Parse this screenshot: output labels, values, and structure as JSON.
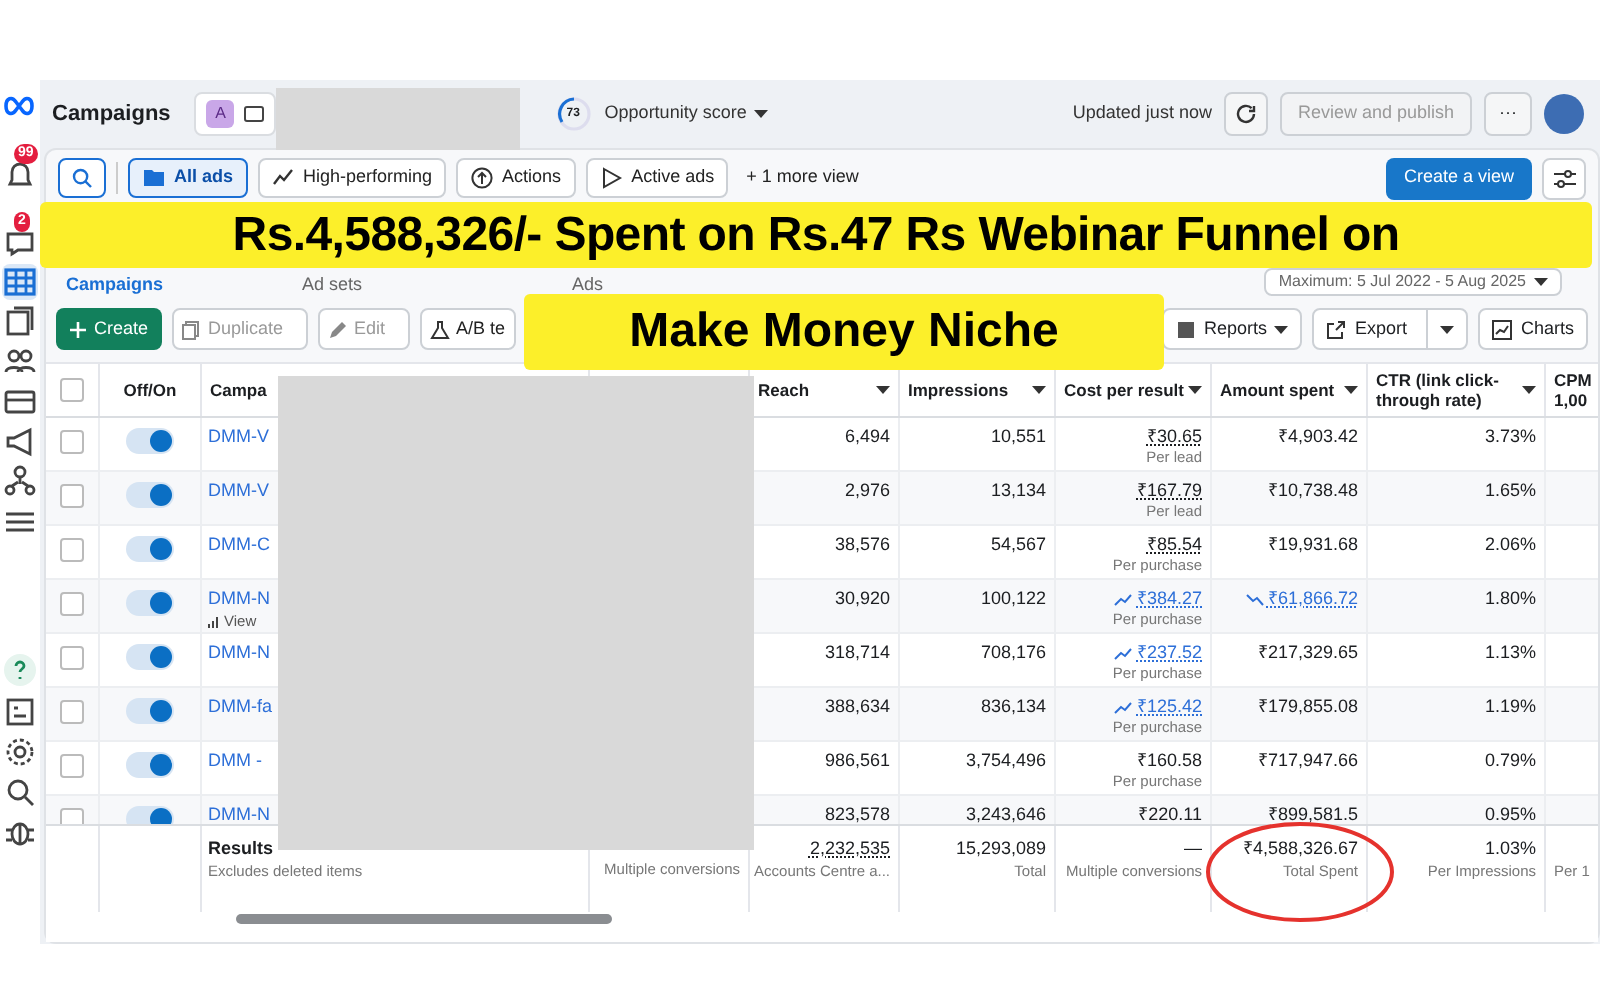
{
  "sidebar": {
    "items": [
      {
        "selected": false
      },
      {
        "selected": false,
        "badge": "99"
      },
      {
        "selected": false,
        "badge": "2"
      },
      {
        "selected": true
      },
      {
        "selected": false
      },
      {
        "selected": false
      },
      {
        "selected": false
      },
      {
        "selected": false
      },
      {
        "selected": false
      },
      {
        "selected": false
      },
      {
        "selected": false
      },
      {
        "selected": false
      },
      {
        "selected": false
      },
      {
        "selected": false
      },
      {
        "selected": false
      }
    ]
  },
  "header": {
    "title": "Campaigns",
    "account_initial": "A",
    "score": "73",
    "score_label": "Opportunity score",
    "updated": "Updated just now",
    "publish": {
      "label": "Review and publish",
      "disabled": true
    },
    "more": "···"
  },
  "views": [
    {
      "label": "All ads",
      "selected": true
    },
    {
      "label": "High-performing",
      "selected": false
    },
    {
      "label": "Actions",
      "selected": false
    },
    {
      "label": "Active ads",
      "selected": false
    }
  ],
  "more_view": "+ 1 more view",
  "create_view": "Create a view",
  "banner": {
    "lines": [
      "Rs.4,588,326/- Spent on Rs.47 Rs Webinar Funnel on",
      "Make Money Niche"
    ]
  },
  "level_tabs": [
    {
      "label": "Campaigns",
      "selected": true
    },
    {
      "label": "Ad sets",
      "selected": false
    },
    {
      "label": "Ads",
      "selected": false
    }
  ],
  "date_range": "Maximum: 5 Jul 2022 - 5 Aug 2025",
  "toolbar": {
    "create": "Create",
    "left": [
      "Duplicate",
      "Edit",
      "A/B te"
    ],
    "reports": "Reports",
    "export": "Export",
    "charts": "Charts"
  },
  "table": {
    "select_all_checked": false,
    "columns": [
      "Off/On",
      "Campa",
      "Reach",
      "Impressions",
      "Cost per result",
      "Amount spent",
      "CTR (link click-through rate)",
      "CPM 1,00"
    ],
    "rows": [
      {
        "checked": false,
        "on": true,
        "name": "DMM-V",
        "reach": "6,494",
        "impressions": "10,551",
        "cost": {
          "kind": "dotted",
          "text": "₹30.65",
          "note": "Per lead"
        },
        "amount": {
          "kind": "plain",
          "text": "₹4,903.42"
        },
        "ctr": "3.73%"
      },
      {
        "checked": false,
        "on": true,
        "name": "DMM-V",
        "reach": "2,976",
        "impressions": "13,134",
        "cost": {
          "kind": "dotted",
          "text": "₹167.79",
          "note": "Per lead"
        },
        "amount": {
          "kind": "plain",
          "text": "₹10,738.48"
        },
        "ctr": "1.65%"
      },
      {
        "checked": false,
        "on": true,
        "name": "DMM-C",
        "reach": "38,576",
        "impressions": "54,567",
        "cost": {
          "kind": "dotted",
          "text": "₹85.54",
          "note": "Per purchase"
        },
        "amount": {
          "kind": "plain",
          "text": "₹19,931.68"
        },
        "ctr": "2.06%"
      },
      {
        "checked": false,
        "on": true,
        "name": "DMM-N",
        "sub": "View",
        "reach": "30,920",
        "impressions": "100,122",
        "cost": {
          "kind": "trend-up",
          "text": "₹384.27",
          "note": "Per purchase"
        },
        "amount": {
          "kind": "trend-down",
          "text": "₹61,866.72"
        },
        "ctr": "1.80%"
      },
      {
        "checked": false,
        "on": true,
        "name": "DMM-N",
        "reach": "318,714",
        "impressions": "708,176",
        "cost": {
          "kind": "trend-up",
          "text": "₹237.52",
          "note": "Per purchase"
        },
        "amount": {
          "kind": "plain",
          "text": "₹217,329.65"
        },
        "ctr": "1.13%"
      },
      {
        "checked": false,
        "on": true,
        "name": "DMM-fa",
        "reach": "388,634",
        "impressions": "836,134",
        "cost": {
          "kind": "trend-up",
          "text": "₹125.42",
          "note": "Per purchase"
        },
        "amount": {
          "kind": "plain",
          "text": "₹179,855.08"
        },
        "ctr": "1.19%"
      },
      {
        "checked": false,
        "on": true,
        "name": "DMM -",
        "reach": "986,561",
        "impressions": "3,754,496",
        "cost": {
          "kind": "plain",
          "text": "₹160.58",
          "note": "Per purchase"
        },
        "amount": {
          "kind": "plain",
          "text": "₹717,947.66"
        },
        "ctr": "0.79%"
      },
      {
        "checked": false,
        "on": true,
        "name": "DMM-N",
        "reach": "823,578",
        "impressions": "3,243,646",
        "cost": {
          "kind": "plain",
          "text": "₹220.11"
        },
        "amount": {
          "kind": "plain",
          "text": "₹899,581.5"
        },
        "ctr": "0.95%"
      }
    ],
    "footer": {
      "results": "Results",
      "results_note": "Excludes deleted items",
      "col5_note": "Multiple conversions",
      "reach": "2,232,535",
      "reach_note": "Accounts Centre a...",
      "impressions": "15,293,089",
      "impressions_note": "Total",
      "cost": "—",
      "cost_note": "Multiple conversions",
      "amount": "₹4,588,326.67",
      "amount_note": "Total Spent",
      "ctr": "1.03%",
      "ctr_note": "Per Impressions",
      "cpm_note": "Per 1"
    }
  }
}
